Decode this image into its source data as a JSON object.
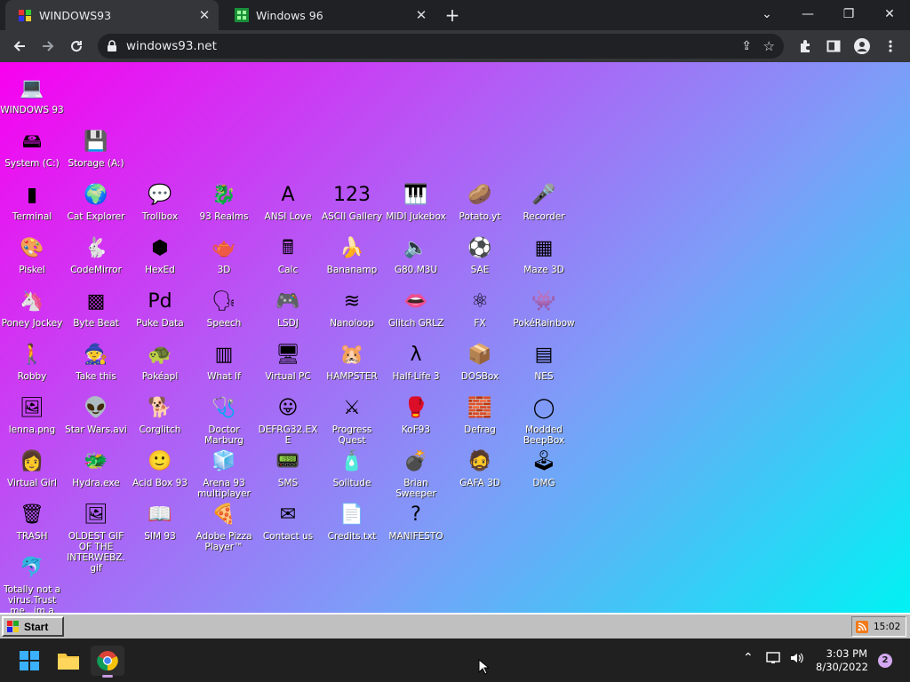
{
  "tabs": [
    {
      "title": "WINDOWS93"
    },
    {
      "title": "Windows 96"
    }
  ],
  "toolbar": {
    "url": "windows93.net"
  },
  "desktop_icons": [
    {
      "label": "WINDOWS 93",
      "glyph": "💻"
    },
    {
      "label": "System (C:)",
      "glyph": "🖴"
    },
    {
      "label": "Storage (A:)",
      "glyph": "💾"
    },
    {
      "label": "Terminal",
      "glyph": "▮"
    },
    {
      "label": "Cat Explorer",
      "glyph": "🌍"
    },
    {
      "label": "Trollbox",
      "glyph": "💬"
    },
    {
      "label": "93 Realms",
      "glyph": "🐉"
    },
    {
      "label": "ANSI Love",
      "glyph": "A"
    },
    {
      "label": "ASCII Gallery",
      "glyph": "123"
    },
    {
      "label": "MIDI Jukebox",
      "glyph": "🎹"
    },
    {
      "label": "Potato.yt",
      "glyph": "🥔"
    },
    {
      "label": "Recorder",
      "glyph": "🎤"
    },
    {
      "label": "Piskel",
      "glyph": "🎨"
    },
    {
      "label": "CodeMirror",
      "glyph": "🐇"
    },
    {
      "label": "HexEd",
      "glyph": "⬢"
    },
    {
      "label": "3D",
      "glyph": "🫖"
    },
    {
      "label": "Calc",
      "glyph": "🖩"
    },
    {
      "label": "Bananamp",
      "glyph": "🍌"
    },
    {
      "label": "G80.M3U",
      "glyph": "🔈"
    },
    {
      "label": "SAE",
      "glyph": "⚽"
    },
    {
      "label": "Maze 3D",
      "glyph": "▦"
    },
    {
      "label": "Poney Jockey",
      "glyph": "🦄"
    },
    {
      "label": "Byte Beat",
      "glyph": "▩"
    },
    {
      "label": "Puke Data",
      "glyph": "Pd"
    },
    {
      "label": "Speech",
      "glyph": "🗣"
    },
    {
      "label": "LSDJ",
      "glyph": "🎮"
    },
    {
      "label": "Nanoloop",
      "glyph": "≋"
    },
    {
      "label": "Glitch GRLZ",
      "glyph": "👄"
    },
    {
      "label": "FX",
      "glyph": "⚛"
    },
    {
      "label": "PokéRainbow",
      "glyph": "👾"
    },
    {
      "label": "Robby",
      "glyph": "🚶"
    },
    {
      "label": "Take this",
      "glyph": "🧙"
    },
    {
      "label": "Pokéapl",
      "glyph": "🐢"
    },
    {
      "label": "What If",
      "glyph": "▥"
    },
    {
      "label": "Virtual PC",
      "glyph": "🖥"
    },
    {
      "label": "HAMPSTER",
      "glyph": "🐹"
    },
    {
      "label": "Half-Life 3",
      "glyph": "λ"
    },
    {
      "label": "DOSBox",
      "glyph": "📦"
    },
    {
      "label": "NES",
      "glyph": "▤"
    },
    {
      "label": "lenna.png",
      "glyph": "🖼"
    },
    {
      "label": "Star Wars.avi",
      "glyph": "👽"
    },
    {
      "label": "Corglitch",
      "glyph": "🐕"
    },
    {
      "label": "Doctor Marburg",
      "glyph": "🩺"
    },
    {
      "label": "DEFRG32.EXE",
      "glyph": "😛"
    },
    {
      "label": "Progress Quest",
      "glyph": "⚔"
    },
    {
      "label": "KoF93",
      "glyph": "🥊"
    },
    {
      "label": "Defrag",
      "glyph": "🧱"
    },
    {
      "label": "Modded BeepBox",
      "glyph": "◯"
    },
    {
      "label": "Virtual Girl",
      "glyph": "👩"
    },
    {
      "label": "Hydra.exe",
      "glyph": "🐲"
    },
    {
      "label": "Acid Box 93",
      "glyph": "🙂"
    },
    {
      "label": "Arena 93 multiplayer",
      "glyph": "🧊"
    },
    {
      "label": "SMS",
      "glyph": "📟"
    },
    {
      "label": "Solitude",
      "glyph": "🧴"
    },
    {
      "label": "Brian Sweeper",
      "glyph": "💣"
    },
    {
      "label": "GAFA 3D",
      "glyph": "🧔"
    },
    {
      "label": "DMG",
      "glyph": "🕹"
    },
    {
      "label": "TRASH",
      "glyph": "🗑"
    },
    {
      "label": "OLDEST GIF OF THE INTERWEBZ.gif",
      "glyph": "🖼"
    },
    {
      "label": "SIM 93",
      "glyph": "📖"
    },
    {
      "label": "Adobe Pizza Player™",
      "glyph": "🍕"
    },
    {
      "label": "Contact us",
      "glyph": "✉"
    },
    {
      "label": "Credits.txt",
      "glyph": "📄"
    },
    {
      "label": "MANIFESTO",
      "glyph": "?"
    },
    {
      "label": "Totally not a virus.Trust me...im a",
      "glyph": "🐬"
    }
  ],
  "w93_taskbar": {
    "start_label": "Start",
    "clock": "15:02"
  },
  "win_taskbar": {
    "time": "3:03 PM",
    "date": "8/30/2022",
    "notifications": "2"
  }
}
